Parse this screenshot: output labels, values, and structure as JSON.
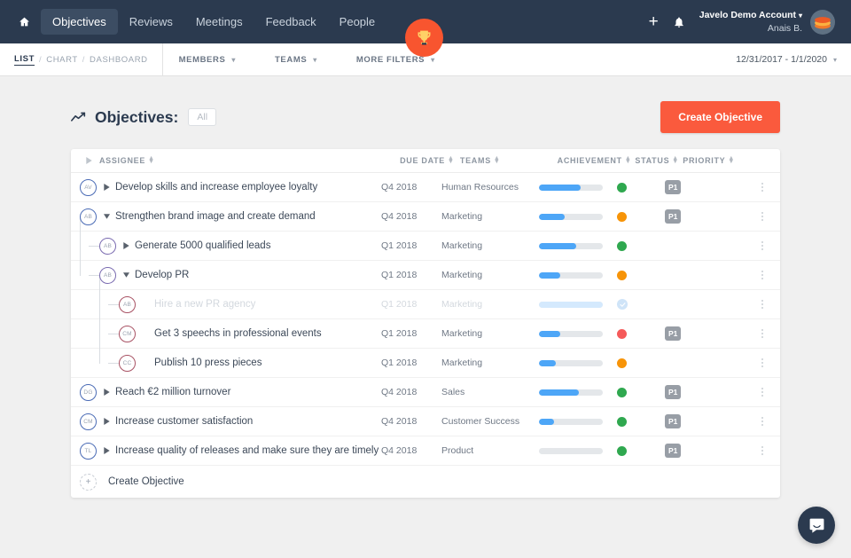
{
  "topnav": {
    "home_icon": "home-icon",
    "tabs": [
      {
        "label": "Objectives",
        "active": true
      },
      {
        "label": "Reviews",
        "active": false
      },
      {
        "label": "Meetings",
        "active": false
      },
      {
        "label": "Feedback",
        "active": false
      },
      {
        "label": "People",
        "active": false
      }
    ],
    "add_icon": "+",
    "bell_icon": "bell-icon",
    "account_name": "Javelo Demo Account",
    "account_caret": "▾",
    "account_user": "Anais B.",
    "badge_icon": "trophy-icon",
    "bg_color": "#2b3a4f",
    "active_tab_bg": "#3c4d63",
    "badge_color": "#f8552f"
  },
  "subnav": {
    "breadcrumb": [
      {
        "label": "LIST",
        "active": true
      },
      {
        "label": "CHART",
        "active": false
      },
      {
        "label": "DASHBOARD",
        "active": false
      }
    ],
    "separator": "/",
    "filters": [
      {
        "label": "MEMBERS",
        "caret": "▾"
      },
      {
        "label": "TEAMS",
        "caret": "▾"
      },
      {
        "label": "MORE FILTERS",
        "caret": "▾"
      }
    ],
    "date_range": "12/31/2017 - 1/1/2020",
    "date_caret": "▾"
  },
  "page": {
    "trend_icon": "trend-line-icon",
    "title": "Objectives:",
    "all_badge": "All",
    "create_button": "Create Objective",
    "create_button_color": "#fa5a3d"
  },
  "table": {
    "columns": [
      {
        "label": "ASSIGNEE",
        "sortable": true
      },
      {
        "label": "DUE DATE",
        "sortable": true
      },
      {
        "label": "TEAMS",
        "sortable": true
      },
      {
        "label": "ACHIEVEMENT",
        "sortable": true
      },
      {
        "label": "STATUS",
        "sortable": true
      },
      {
        "label": "PRIORITY",
        "sortable": true
      }
    ],
    "rows": [
      {
        "initials": "AV",
        "level": 0,
        "ring": "blue",
        "caret": "right",
        "title": "Develop skills and increase employee loyalty",
        "due": "Q4 2018",
        "team": "Human Resources",
        "achievement": 65,
        "status": "green",
        "priority": "P1",
        "dim": false
      },
      {
        "initials": "AB",
        "level": 0,
        "ring": "blue",
        "caret": "down",
        "title": "Strengthen brand image and create demand",
        "due": "Q4 2018",
        "team": "Marketing",
        "achievement": 40,
        "status": "orange",
        "priority": "P1",
        "dim": false
      },
      {
        "initials": "AB",
        "level": 1,
        "ring": "purple",
        "caret": "right",
        "title": "Generate 5000 qualified leads",
        "due": "Q1 2018",
        "team": "Marketing",
        "achievement": 58,
        "status": "green",
        "priority": "",
        "dim": false
      },
      {
        "initials": "AB",
        "level": 1,
        "ring": "purple",
        "caret": "down",
        "title": "Develop PR",
        "due": "Q1 2018",
        "team": "Marketing",
        "achievement": 34,
        "status": "orange",
        "priority": "",
        "dim": false
      },
      {
        "initials": "AB",
        "level": 2,
        "ring": "maroon",
        "caret": "none",
        "title": "Hire a new PR agency",
        "due": "Q1 2018",
        "team": "Marketing",
        "achievement": 100,
        "status": "check",
        "priority": "",
        "dim": true
      },
      {
        "initials": "CM",
        "level": 2,
        "ring": "maroon",
        "caret": "none",
        "title": "Get 3 speechs in professional events",
        "due": "Q1 2018",
        "team": "Marketing",
        "achievement": 34,
        "status": "red",
        "priority": "P1",
        "dim": false
      },
      {
        "initials": "CC",
        "level": 2,
        "ring": "maroon",
        "caret": "none",
        "title": "Publish 10 press pieces",
        "due": "Q1 2018",
        "team": "Marketing",
        "achievement": 27,
        "status": "orange",
        "priority": "",
        "dim": false
      },
      {
        "initials": "DG",
        "level": 0,
        "ring": "blue",
        "caret": "right",
        "title": "Reach €2 million turnover",
        "due": "Q4 2018",
        "team": "Sales",
        "achievement": 63,
        "status": "green",
        "priority": "P1",
        "dim": false
      },
      {
        "initials": "CM",
        "level": 0,
        "ring": "blue",
        "caret": "right",
        "title": "Increase customer satisfaction",
        "due": "Q4 2018",
        "team": "Customer Success",
        "achievement": 24,
        "status": "green",
        "priority": "P1",
        "dim": false
      },
      {
        "initials": "TL",
        "level": 0,
        "ring": "blue",
        "caret": "right",
        "title": "Increase quality of releases and make sure they are timely",
        "due": "Q4 2018",
        "team": "Product",
        "achievement": 0,
        "status": "green",
        "priority": "P1",
        "dim": false
      }
    ],
    "create_row": {
      "plus": "+",
      "label": "Create Objective"
    }
  },
  "chat": {
    "icon": "chat-bubble-icon",
    "color": "#2b3a4f"
  }
}
